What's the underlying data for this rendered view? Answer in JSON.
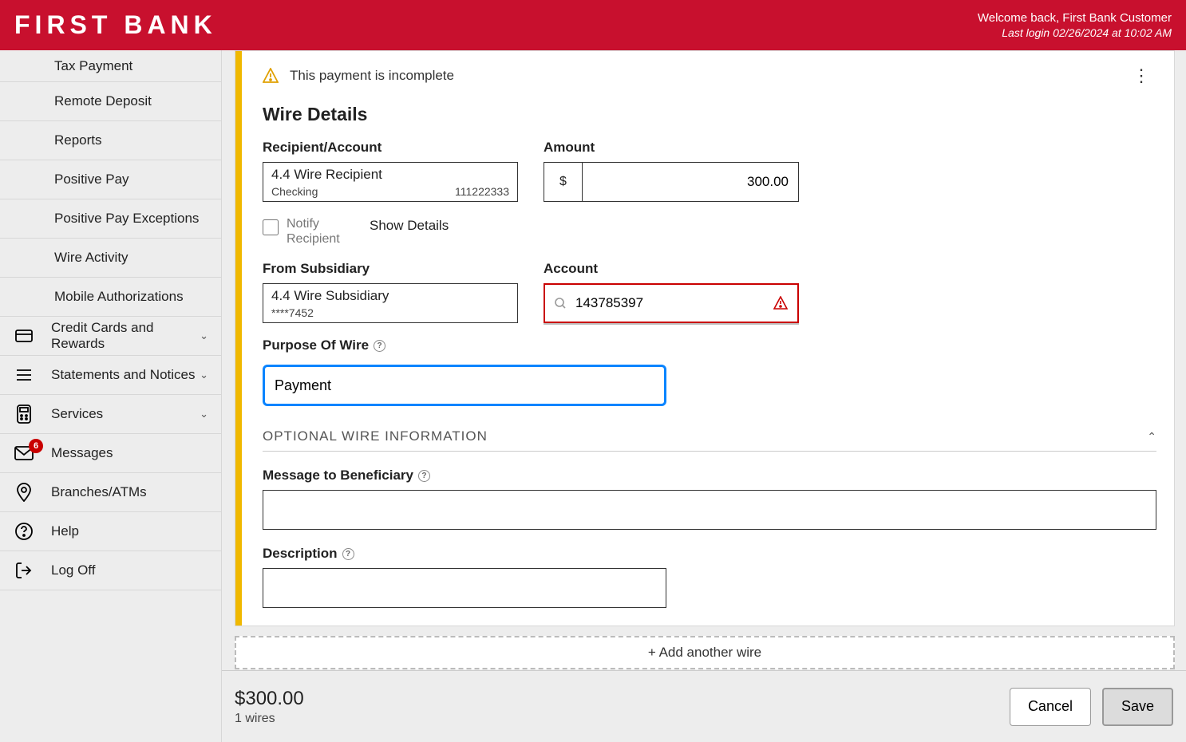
{
  "header": {
    "logo_text": "FIRST BANK",
    "welcome": "Welcome back, First Bank Customer",
    "last_login": "Last login 02/26/2024 at 10:02 AM"
  },
  "sidebar": {
    "items": [
      {
        "label": "Tax Payment",
        "indent": true
      },
      {
        "label": "Remote Deposit",
        "indent": true
      },
      {
        "label": "Reports",
        "indent": true
      },
      {
        "label": "Positive Pay",
        "indent": true
      },
      {
        "label": "Positive Pay Exceptions",
        "indent": true
      },
      {
        "label": "Wire Activity",
        "indent": true
      },
      {
        "label": "Mobile Authorizations",
        "indent": true
      },
      {
        "label": "Credit Cards and Rewards",
        "icon": "card",
        "chevron": true
      },
      {
        "label": "Statements and Notices",
        "icon": "list",
        "chevron": true
      },
      {
        "label": "Services",
        "icon": "calculator",
        "chevron": true
      },
      {
        "label": "Messages",
        "icon": "mail",
        "badge": "6"
      },
      {
        "label": "Branches/ATMs",
        "icon": "pin"
      },
      {
        "label": "Help",
        "icon": "help"
      },
      {
        "label": "Log Off",
        "icon": "logoff"
      }
    ]
  },
  "alert": {
    "text": "This payment is incomplete"
  },
  "wire": {
    "section_title": "Wire Details",
    "recipient_label": "Recipient/Account",
    "recipient": {
      "name": "4.4 Wire Recipient",
      "type": "Checking",
      "acct": "111222333"
    },
    "amount_label": "Amount",
    "amount_prefix": "$",
    "amount_value": "300.00",
    "notify_label": "Notify Recipient",
    "show_details": "Show Details",
    "from_sub_label": "From Subsidiary",
    "from_sub": {
      "name": "4.4 Wire Subsidiary",
      "acct": "****7452"
    },
    "account_label": "Account",
    "account_value": "143785397",
    "purpose_label": "Purpose Of Wire",
    "purpose_value": "Payment",
    "optional_header": "OPTIONAL WIRE INFORMATION",
    "msg_label": "Message to Beneficiary",
    "msg_value": "",
    "desc_label": "Description",
    "desc_value": ""
  },
  "add_wire": "+ Add another wire",
  "footer": {
    "total": "$300.00",
    "count": "1 wires",
    "cancel": "Cancel",
    "save": "Save"
  }
}
